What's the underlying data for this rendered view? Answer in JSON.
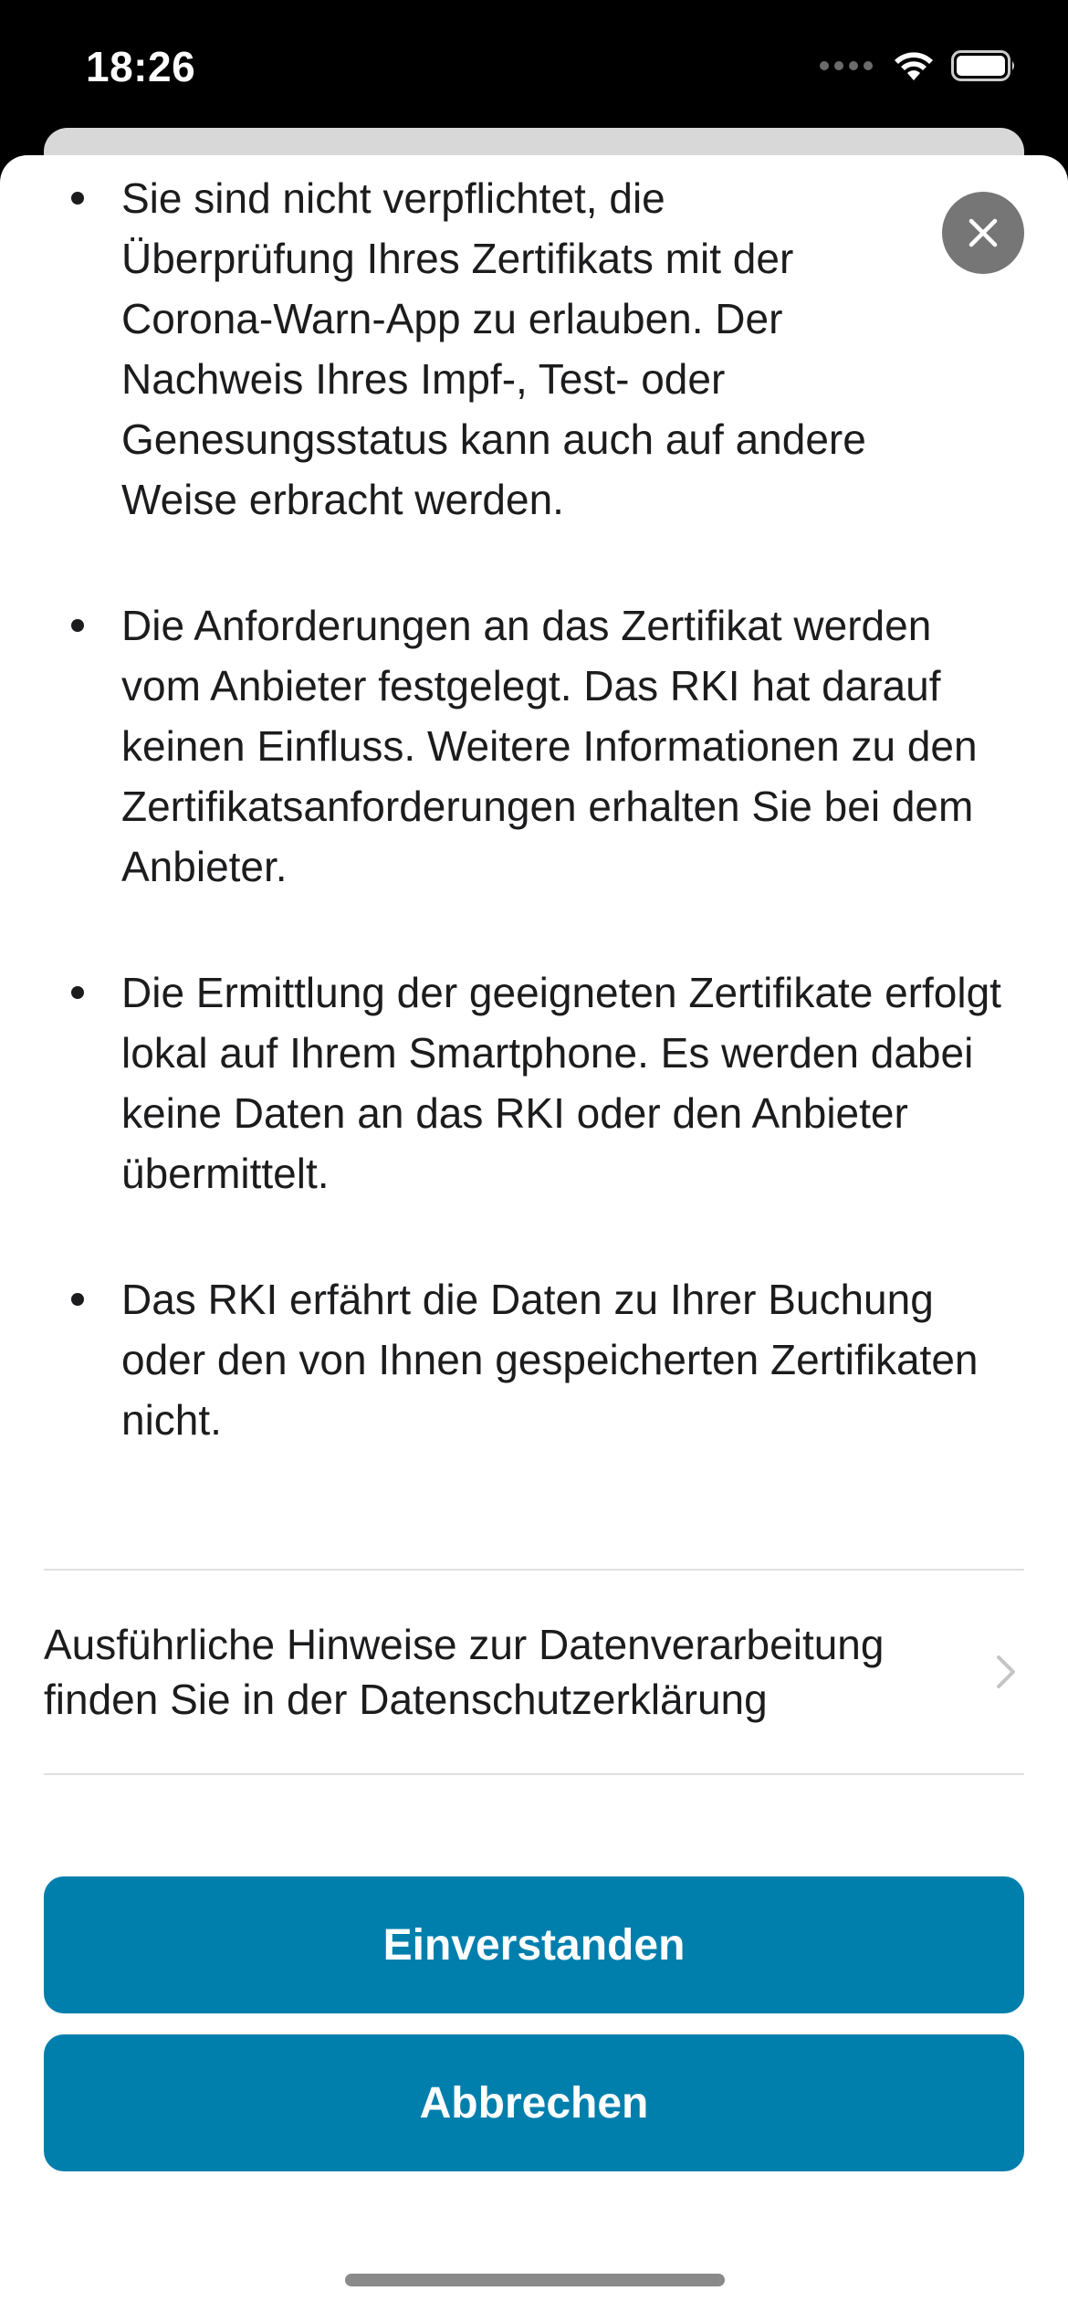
{
  "status_bar": {
    "time": "18:26",
    "icons": [
      "cellular-signal-icon",
      "wifi-icon",
      "battery-icon"
    ]
  },
  "sheet": {
    "close_icon": "close-icon",
    "bullets": [
      "Sie sind nicht verpflichtet, die Überprüfung Ihres Zertifikats mit der Corona-Warn-App zu erlauben. Der Nachweis Ihres Impf-, Test- oder Genesungsstatus kann auch auf andere Weise erbracht werden.",
      "Die Anforderungen an das Zertifikat werden vom Anbieter festgelegt. Das RKI hat darauf keinen Einfluss. Weitere Informationen zu den Zertifikatsanforderungen erhalten Sie bei dem Anbieter.",
      "Die Ermittlung der geeigneten Zertifikate erfolgt lokal auf Ihrem Smartphone. Es werden dabei keine Daten an das RKI oder den Anbieter übermittelt.",
      "Das RKI erfährt die Daten zu Ihrer Buchung oder den von Ihnen gespeicherten Zertifikaten nicht."
    ],
    "privacy_link": "Ausführliche Hinweise zur Datenverarbeitung finden Sie in der Datenschutzerklärung",
    "agree_label": "Einverstanden",
    "cancel_label": "Abbrechen"
  },
  "colors": {
    "primary": "#007fad",
    "text": "#1c1c1e",
    "close_bg": "#767676"
  }
}
